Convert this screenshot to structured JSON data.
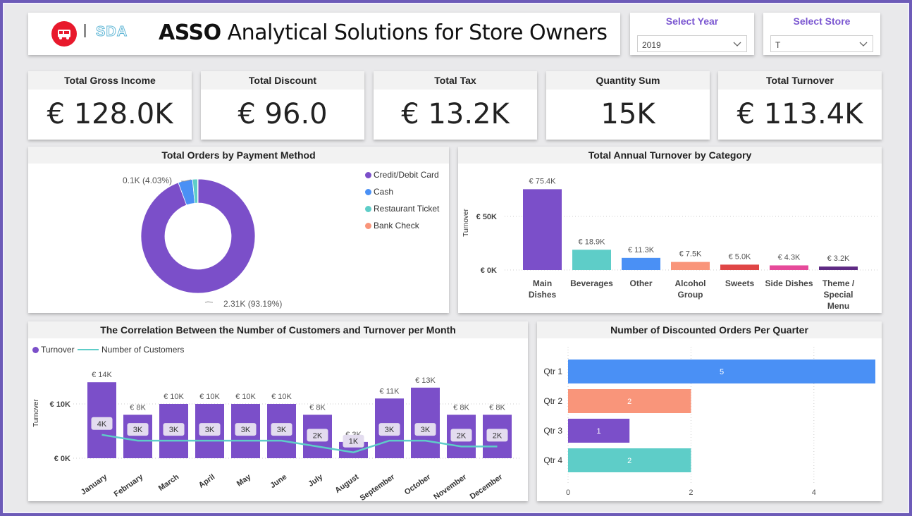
{
  "header": {
    "brand_sep": "|",
    "brand_sda": "SDA",
    "title_bold": "ASSO",
    "title_rest": " Analytical Solutions for Store Owners"
  },
  "slicers": {
    "year": {
      "label": "Select Year",
      "value": "2019"
    },
    "store": {
      "label": "Select Store",
      "value": "T"
    }
  },
  "kpis": [
    {
      "label": "Total Gross Income",
      "value": "€ 128.0K"
    },
    {
      "label": "Total Discount",
      "value": "€ 96.0"
    },
    {
      "label": "Total Tax",
      "value": "€ 13.2K"
    },
    {
      "label": "Quantity Sum",
      "value": "15K"
    },
    {
      "label": "Total Turnover",
      "value": "€ 113.4K"
    }
  ],
  "colors": {
    "purple": "#7b4fc9",
    "teal": "#5ecdc8",
    "blue": "#4a90f5",
    "salmon": "#f9957a",
    "red": "#e04646",
    "pink": "#e64a9a",
    "darkpurple": "#5e2a84"
  },
  "chart_data": [
    {
      "type": "pie",
      "title": "Total Orders by Payment Method",
      "categories": [
        "Credit/Debit Card",
        "Cash",
        "Restaurant Ticket",
        "Bank Check"
      ],
      "values": [
        2.31,
        0.1,
        0.035,
        0.003
      ],
      "data_labels": [
        "2.31K (93.19%)",
        "0.1K (4.03%)"
      ],
      "colors": [
        "#7b4fc9",
        "#4a90f5",
        "#5ecdc8",
        "#f9957a"
      ],
      "legend": "right"
    },
    {
      "type": "bar",
      "title": "Total Annual Turnover by Category",
      "ylabel": "Turnover",
      "y_ticks": [
        "€ 0K",
        "€ 50K"
      ],
      "ylim": [
        0,
        100000
      ],
      "categories": [
        [
          "Main",
          "Dishes"
        ],
        [
          "Beverages"
        ],
        [
          "Other"
        ],
        [
          "Alcohol",
          "Group"
        ],
        [
          "Sweets"
        ],
        [
          "Side Dishes"
        ],
        [
          "Theme /",
          "Special",
          "Menu"
        ]
      ],
      "values": [
        75400,
        18900,
        11300,
        7500,
        5000,
        4300,
        3200
      ],
      "data_labels": [
        "€ 75.4K",
        "€ 18.9K",
        "€ 11.3K",
        "€ 7.5K",
        "€ 5.0K",
        "€ 4.3K",
        "€ 3.2K"
      ],
      "colors": [
        "#7b4fc9",
        "#5ecdc8",
        "#4a90f5",
        "#f9957a",
        "#e04646",
        "#e64a9a",
        "#5e2a84"
      ]
    },
    {
      "type": "bar",
      "title": "The Correlation Between the Number of Customers and Turnover per Month",
      "ylabel": "Turnover",
      "y_ticks": [
        "€ 0K",
        "€ 10K"
      ],
      "ylim": [
        0,
        20000
      ],
      "legend": "top-left",
      "categories": [
        "January",
        "February",
        "March",
        "April",
        "May",
        "June",
        "July",
        "August",
        "September",
        "October",
        "November",
        "December"
      ],
      "series": [
        {
          "name": "Turnover",
          "type": "bar",
          "values": [
            14000,
            8000,
            10000,
            10000,
            10000,
            10000,
            8000,
            3000,
            11000,
            13000,
            8000,
            8000
          ],
          "labels": [
            "€ 14K",
            "€ 8K",
            "€ 10K",
            "€ 10K",
            "€ 10K",
            "€ 10K",
            "€ 8K",
            "€ 3K",
            "€ 11K",
            "€ 13K",
            "€ 8K",
            "€ 8K"
          ]
        },
        {
          "name": "Number of Customers",
          "type": "line",
          "values": [
            4000,
            3000,
            3000,
            3000,
            3000,
            3000,
            2000,
            1000,
            3000,
            3000,
            2000,
            2000
          ],
          "labels": [
            "4K",
            "3K",
            "3K",
            "3K",
            "3K",
            "3K",
            "2K",
            "1K",
            "3K",
            "3K",
            "2K",
            "2K"
          ]
        }
      ]
    },
    {
      "type": "bar",
      "title": "Number of Discounted Orders Per Quarter",
      "orientation": "horizontal",
      "categories": [
        "Qtr 1",
        "Qtr 2",
        "Qtr 3",
        "Qtr 4"
      ],
      "values": [
        5,
        2,
        1,
        2
      ],
      "x_ticks": [
        "0",
        "2",
        "4"
      ],
      "xlim": [
        0,
        5
      ],
      "colors": [
        "#4a90f5",
        "#f9957a",
        "#7b4fc9",
        "#5ecdc8"
      ]
    }
  ]
}
